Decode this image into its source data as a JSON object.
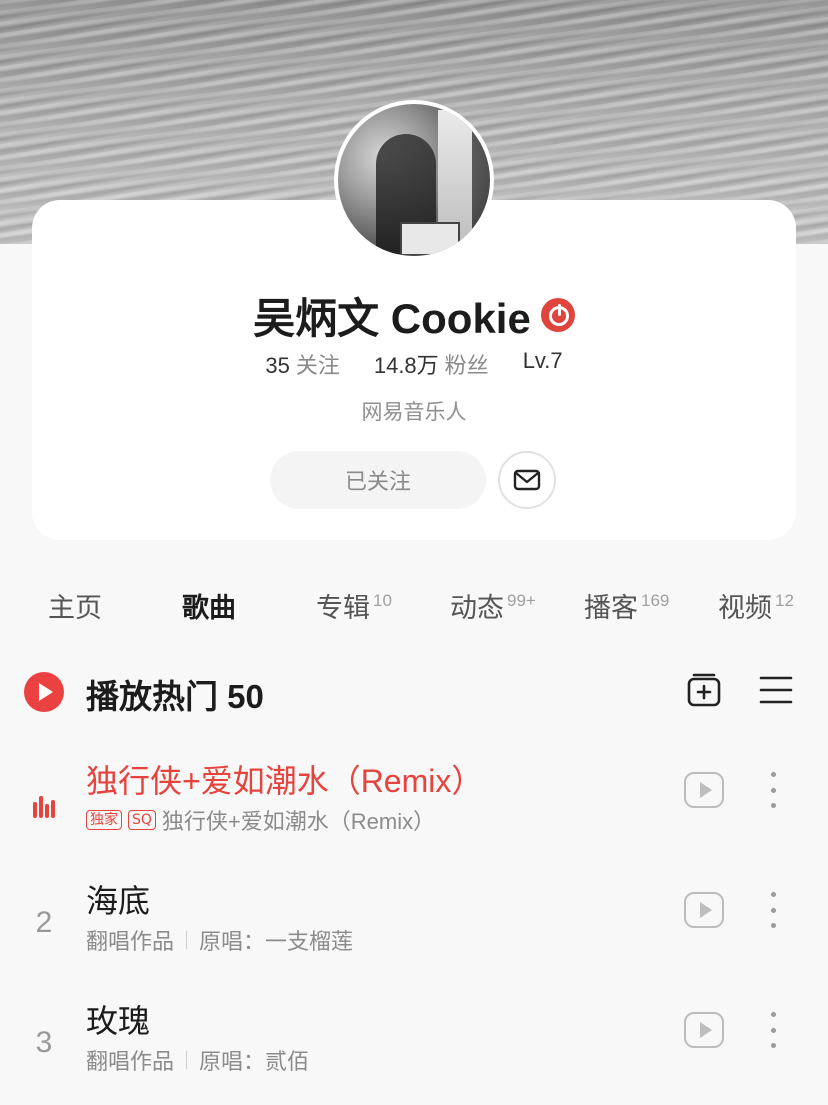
{
  "profile": {
    "name": "吴炳文 Cookie",
    "following_count": "35",
    "following_label": "关注",
    "fans_count": "14.8万",
    "fans_label": "粉丝",
    "level": "Lv.7",
    "subtitle": "网易音乐人",
    "follow_button": "已关注",
    "verify_icon": "musician-verified-icon",
    "mail_icon": "mail-icon"
  },
  "tabs": [
    {
      "label": "主页",
      "count": ""
    },
    {
      "label": "歌曲",
      "count": ""
    },
    {
      "label": "专辑",
      "count": "10"
    },
    {
      "label": "动态",
      "count": "99+"
    },
    {
      "label": "播客",
      "count": "169"
    },
    {
      "label": "视频",
      "count": "12"
    }
  ],
  "active_tab": "歌曲",
  "hot": {
    "title": "播放热门 50",
    "play_icon": "play-circle-icon",
    "add_icon": "add-to-playlist-icon",
    "menu_icon": "multi-select-icon"
  },
  "songs": [
    {
      "rank": "",
      "title": "独行侠+爱如潮水（Remix）",
      "badges": [
        "独家",
        "SQ"
      ],
      "sub": "独行侠+爱如潮水（Remix）",
      "playing": true
    },
    {
      "rank": "2",
      "title": "海底",
      "tag": "翻唱作品",
      "sub": "原唱：一支榴莲",
      "playing": false
    },
    {
      "rank": "3",
      "title": "玫瑰",
      "tag": "翻唱作品",
      "sub": "原唱：贰佰",
      "playing": false
    }
  ],
  "colors": {
    "accent": "#ec4141",
    "background": "#f8f8f8",
    "card": "#ffffff"
  }
}
